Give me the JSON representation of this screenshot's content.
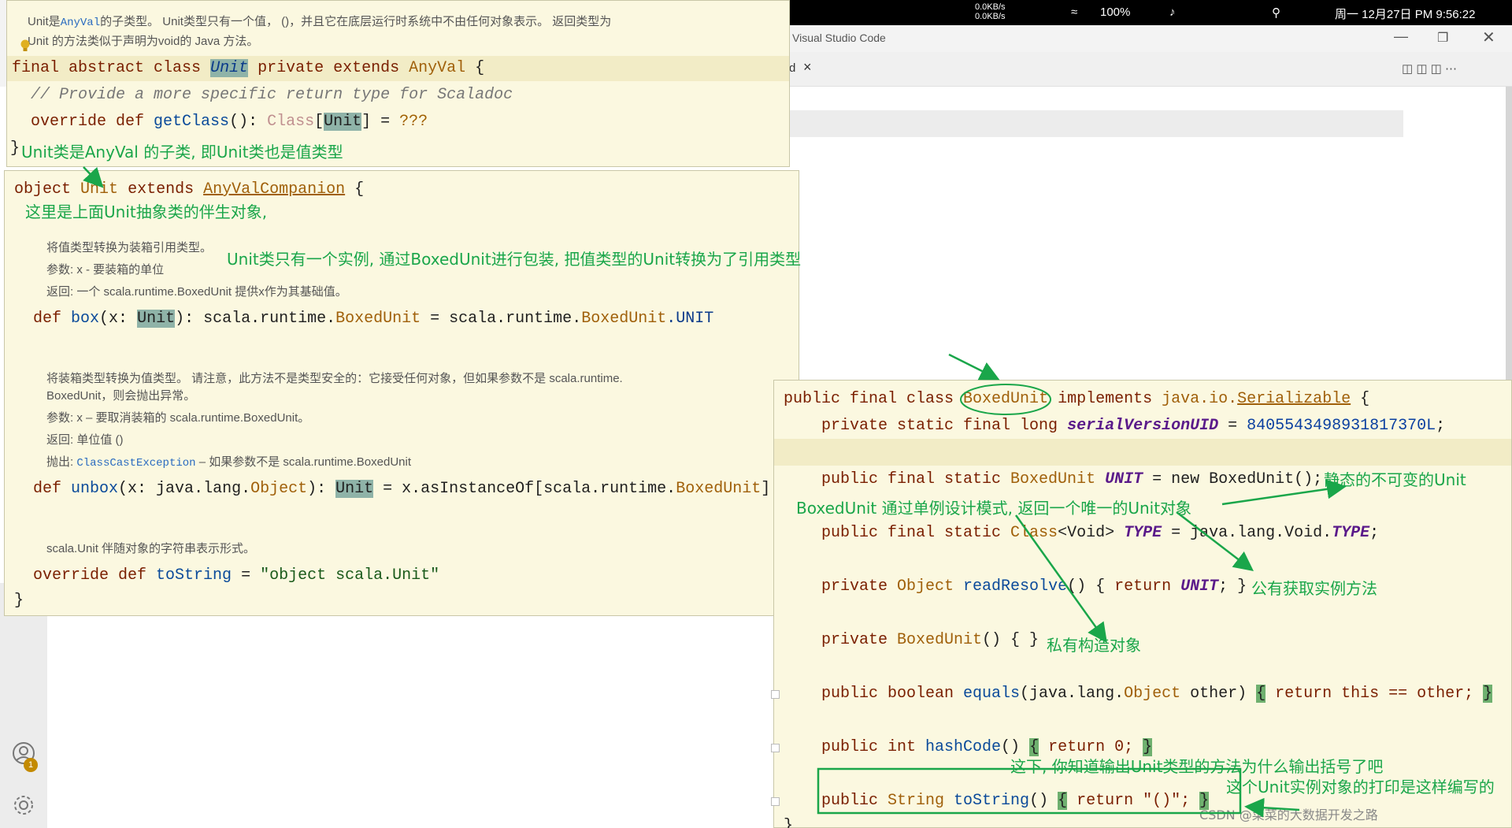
{
  "vscode": {
    "title": "Visual Studio Code",
    "tab_suffix": "d",
    "close_label": "×"
  },
  "systembar": {
    "net_up": "0.0KB/s",
    "net_down": "0.0KB/s",
    "battery": "100%",
    "clock": "周一 12月27日 PM 9:56:22"
  },
  "unit_popup": {
    "doc_line1_pre": "Unit是",
    "doc_line1_link": "AnyVal",
    "doc_line1_post": "的子类型。 Unit类型只有一个值， ()，并且它在底层运行时系统中不由任何对象表示。 返回类型为",
    "doc_line2": "Unit 的方法类似于声明为void的 Java 方法。",
    "code": {
      "l1_kw": "final abstract class",
      "l1_name": "Unit",
      "l1_kw2": "private extends",
      "l1_type": "AnyVal",
      "l1_brace": "{",
      "l2_comment": "// Provide a more specific return type for Scaladoc",
      "l3_kw": "override def",
      "l3_fn": "getClass",
      "l3_sig": "(): ",
      "l3_class": "Class",
      "l3_open": "[",
      "l3_unit": "Unit",
      "l3_close": "] = ",
      "l3_q": "???",
      "l4_brace": "}"
    },
    "annotation": "Unit类是AnyVal 的子类, 即Unit类也是值类型"
  },
  "object_popup": {
    "code": {
      "l1_kw": "object",
      "l1_name": "Unit",
      "l1_kw2": "extends",
      "l1_type": "AnyValCompanion",
      "l1_brace": "{",
      "box_kw": "def",
      "box_fn": "box",
      "box_p1": "(x: ",
      "box_unit": "Unit",
      "box_p2": "): scala.runtime.",
      "box_t1": "BoxedUnit",
      "box_p3": " = scala.runtime.",
      "box_t2": "BoxedUnit",
      "box_p4": ".UNIT",
      "unbox_kw": "def",
      "unbox_fn": "unbox",
      "unbox_p1": "(x: java.lang.",
      "unbox_obj": "Object",
      "unbox_p2": "): ",
      "unbox_unit": "Unit",
      "unbox_p3": " = x.asInstanceOf[scala.runtime.",
      "unbox_t": "BoxedUnit",
      "unbox_p4": "]",
      "ts_kw": "override def",
      "ts_fn": "toString",
      "ts_eq": " = ",
      "ts_str": "\"object scala.Unit\"",
      "close_brace": "}"
    },
    "annotation_companion": "这里是上面Unit抽象类的伴生对象,",
    "annotation_instance": "Unit类只有一个实例, 通过BoxedUnit进行包装, 把值类型的Unit转换为了引用类型",
    "box_doc": {
      "desc": "将值类型转换为装箱引用类型。",
      "param": "参数:   x - 要装箱的单位",
      "ret": "返回:   一个 scala.runtime.BoxedUnit 提供x作为其基础值。"
    },
    "unbox_doc": {
      "desc1": "将装箱类型转换为值类型。 请注意，此方法不是类型安全的：它接受任何对象，但如果参数不是 scala.runtime.",
      "desc2": "BoxedUnit，则会抛出异常。",
      "param": "参数:   x – 要取消装箱的 scala.runtime.BoxedUnit。",
      "ret": "返回:   单位值 ()",
      "throws_label": "抛出:",
      "throws_link": "ClassCastException",
      "throws_text": "– 如果参数不是 scala.runtime.BoxedUnit"
    },
    "tostring_doc": "scala.Unit 伴随对象的字符串表示形式。"
  },
  "boxed_popup": {
    "l1": {
      "kw": "public final class ",
      "name": "BoxedUnit",
      "kw2": " implements ",
      "pkg": "java.io.",
      "iface": "Serializable",
      "brace": " {"
    },
    "l2": {
      "kw": "private static final long ",
      "field": "serialVersionUID",
      "eq": " = ",
      "num": "8405543498931817370L",
      "semi": ";"
    },
    "l3": {
      "kw": "public final static ",
      "type": "BoxedUnit",
      "sp": " ",
      "field": "UNIT",
      "rest": " = new BoxedUnit();"
    },
    "l4": {
      "kw": "public final static ",
      "type": "Class",
      "gen": "<Void> ",
      "field": "TYPE",
      "rest": " = java.lang.Void.",
      "field2": "TYPE",
      "semi": ";"
    },
    "l5": {
      "kw": "private ",
      "type": "Object",
      "sp": " ",
      "fn": "readResolve",
      "p": "() { ",
      "ret": "return ",
      "field": "UNIT",
      "end": "; }"
    },
    "l6": {
      "kw": "private ",
      "type": "BoxedUnit",
      "p": "() { }"
    },
    "l7": {
      "kw": "public boolean ",
      "fn": "equals",
      "p": "(java.lang.",
      "type": "Object",
      "p2": " other) ",
      "ob": "{",
      "ret": " return this == other; ",
      "cb": "}"
    },
    "l8": {
      "kw": "public int ",
      "fn": "hashCode",
      "p": "() ",
      "ob": "{",
      "ret": " return 0; ",
      "cb": "}"
    },
    "l9": {
      "kw": "public ",
      "type": "String",
      "sp": " ",
      "fn": "toString",
      "p": "() ",
      "ob": "{",
      "ret": " return \"()\"; ",
      "cb": "}"
    },
    "closing": "}",
    "annotations": {
      "static_unit": "静态的不可变的Unit",
      "singleton": "BoxedUnit 通过单例设计模式, 返回一个唯一的Unit对象",
      "public_getter": "公有获取实例方法",
      "private_ctor": "私有构造对象",
      "why_parens": "这下, 你知道输出Unit类型的方法为什么输出括号了吧",
      "tostring_note": "这个Unit实例对象的打印是这样编写的"
    }
  },
  "watermark": "CSDN @菜菜的大数据开发之路",
  "badge_count": "1",
  "colors": {
    "popup_bg": "#fbf8e0",
    "annotation_green": "#1aa64a",
    "highlight": "#8fb3a8"
  },
  "icons": [
    "lightbulb-icon",
    "account-icon",
    "gear-icon",
    "wifi-icon",
    "volume-icon",
    "search-icon",
    "close-icon",
    "split-editor-icon"
  ]
}
